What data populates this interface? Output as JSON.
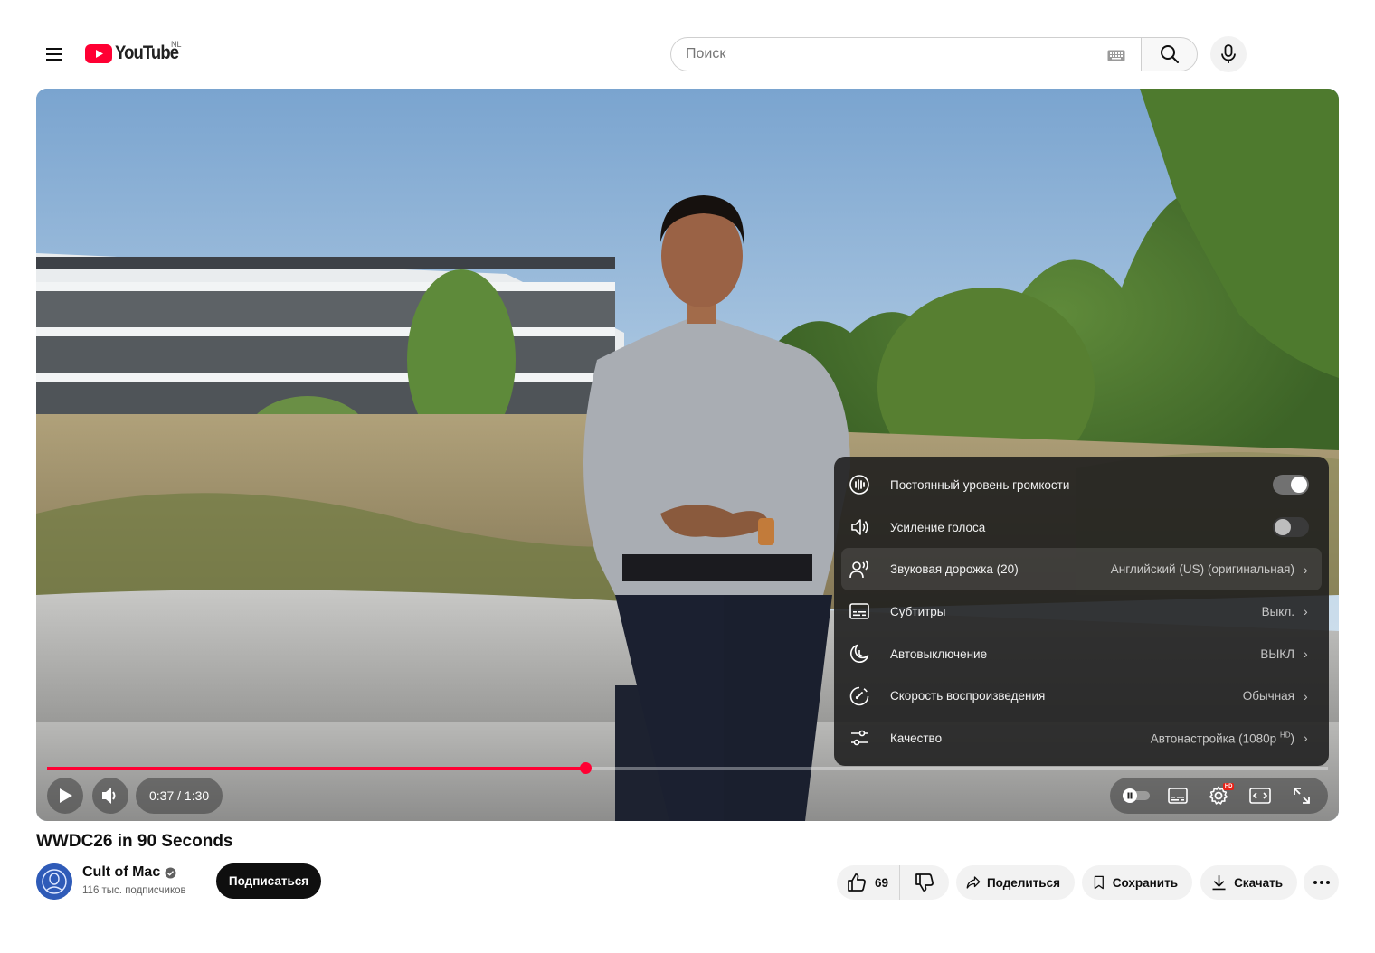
{
  "header": {
    "logo_text": "YouTube",
    "country_code": "NL",
    "search_placeholder": "Поиск"
  },
  "player": {
    "time_display": "0:37 / 1:30",
    "progress_fraction": 0.42,
    "settings_menu": [
      {
        "icon": "stable-volume-icon",
        "label": "Постоянный уровень громкости",
        "type": "toggle",
        "on": true
      },
      {
        "icon": "voice-boost-icon",
        "label": "Усиление голоса",
        "type": "toggle",
        "on": false
      },
      {
        "icon": "audio-track-icon",
        "label": "Звуковая дорожка (20)",
        "value": "Английский (US) (оригинальная)",
        "type": "nav",
        "highlighted": true
      },
      {
        "icon": "subtitles-icon",
        "label": "Субтитры",
        "value": "Выкл.",
        "type": "nav"
      },
      {
        "icon": "sleep-timer-icon",
        "label": "Автовыключение",
        "value": "ВЫКЛ",
        "type": "nav"
      },
      {
        "icon": "playback-speed-icon",
        "label": "Скорость воспроизведения",
        "value": "Обычная",
        "type": "nav"
      },
      {
        "icon": "quality-icon",
        "label": "Качество",
        "value": "Автонастройка (1080p",
        "value_sup": "HD",
        "value_tail": ")",
        "type": "nav"
      }
    ],
    "hd_badge": "HD"
  },
  "video": {
    "title": "WWDC26 in 90 Seconds",
    "channel_name": "Cult of Mac",
    "subscribers": "116 тыс. подписчиков",
    "subscribe_label": "Подписаться"
  },
  "actions": {
    "like_count": "69",
    "share_label": "Поделиться",
    "save_label": "Сохранить",
    "download_label": "Скачать"
  },
  "colors": {
    "brand_red": "#ff0033",
    "text_primary": "#0f0f0f"
  }
}
